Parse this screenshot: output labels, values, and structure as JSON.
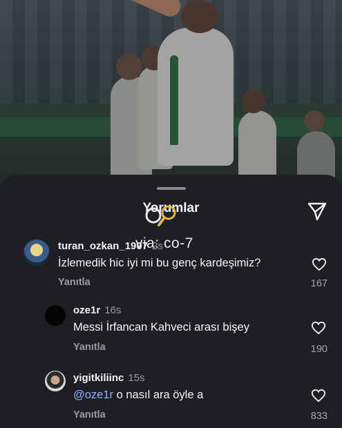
{
  "sheet": {
    "title": "Yorumlar",
    "watermark": "via: co-7"
  },
  "comments": [
    {
      "username": "turan_ozkan_1907",
      "time": "2s",
      "text": "İzlemedik hic iyi mi bu genç kardeşimiz?",
      "reply_label": "Yanıtla",
      "likes": "167"
    },
    {
      "username": "oze1r",
      "time": "16s",
      "text": "Messi İrfancan Kahveci arası bişey",
      "reply_label": "Yanıtla",
      "likes": "190"
    },
    {
      "username": "yigitkiliinc",
      "time": "15s",
      "mention": "@oze1r",
      "text": "o nasıl ara öyle a",
      "reply_label": "Yanıtla",
      "likes": "833"
    }
  ],
  "colors": {
    "sheet_bg": "#1e1f24",
    "mention": "#8fb3ff",
    "muted": "#9b9ca1"
  }
}
